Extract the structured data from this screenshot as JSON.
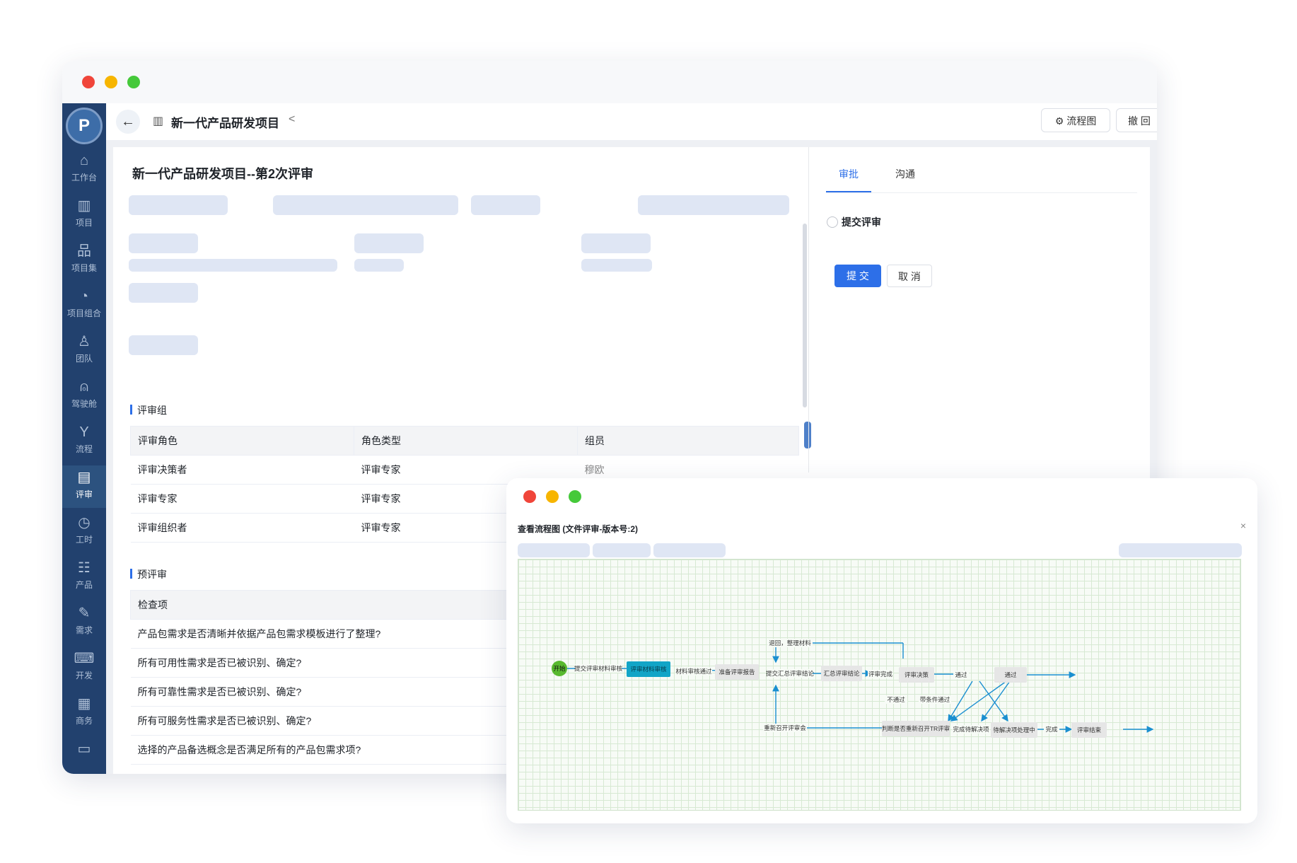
{
  "window": {
    "project_title": "新一代产品研发项目",
    "btn_flowchart": "流程图",
    "btn_withdraw": "撤 回",
    "btn_more": "···",
    "back_icon": "arrow-left-icon",
    "share_icon": "share-icon"
  },
  "sidebar": {
    "logo": "P",
    "items": [
      {
        "label": "工作台",
        "icon": "home-icon"
      },
      {
        "label": "项目",
        "icon": "board-icon"
      },
      {
        "label": "项目集",
        "icon": "hierarchy-icon"
      },
      {
        "label": "项目组合",
        "icon": "gauge-icon"
      },
      {
        "label": "团队",
        "icon": "team-icon"
      },
      {
        "label": "驾驶舱",
        "icon": "alarm-icon"
      },
      {
        "label": "流程",
        "icon": "branch-icon"
      },
      {
        "label": "评审",
        "icon": "review-icon"
      },
      {
        "label": "工时",
        "icon": "clock-icon"
      },
      {
        "label": "产品",
        "icon": "grid-list-icon"
      },
      {
        "label": "需求",
        "icon": "edit-icon"
      },
      {
        "label": "开发",
        "icon": "terminal-icon"
      },
      {
        "label": "商务",
        "icon": "business-icon"
      },
      {
        "label": "",
        "icon": "book-icon"
      }
    ],
    "icons_glyph": [
      "⌂",
      "▥",
      "品",
      "◔",
      "♙",
      "⍝",
      "Y",
      "▤",
      "◷",
      "☷",
      "✎",
      "⌨",
      "▦",
      "▭"
    ]
  },
  "doc": {
    "title": "新一代产品研发项目--第2次评审",
    "review_group_heading": "评审组",
    "review_group": {
      "headers": [
        "评审角色",
        "角色类型",
        "组员"
      ],
      "rows": [
        [
          "评审决策者",
          "评审专家",
          "穆欧"
        ],
        [
          "评审专家",
          "评审专家",
          ""
        ],
        [
          "评审组织者",
          "评审专家",
          ""
        ]
      ]
    },
    "prereview_heading": "预评审",
    "prereview": {
      "header": "检查项",
      "rows": [
        "产品包需求是否清晰并依据产品包需求模板进行了整理?",
        "所有可用性需求是否已被识别、确定?",
        "所有可靠性需求是否已被识别、确定?",
        "所有可服务性需求是否已被识别、确定?",
        "选择的产品备选概念是否满足所有的产品包需求项?"
      ]
    }
  },
  "right_panel": {
    "tabs": [
      "审批",
      "沟通"
    ],
    "active_tab": "审批",
    "option": "提交评审",
    "submit": "提 交",
    "cancel": "取 消"
  },
  "popup": {
    "title": "查看流程图 (文件评审-版本号:2)",
    "close": "×",
    "flow": {
      "nodes": {
        "start": "开始",
        "n1": "评审材料审核",
        "n2": "准备评审报告",
        "n3": "汇总评审结论",
        "n4": "评审决策",
        "n5": "通过",
        "n6": "判断是否重新召开TR评审",
        "n7": "待解决项处理中",
        "n8": "评审结束"
      },
      "edges": {
        "e1": "提交评审材料审核",
        "e2": "材料审核通过",
        "e3": "提交汇总评审结论",
        "e4": "评审完成",
        "e5": "通过",
        "e_back": "退回，整理材料",
        "e_fail": "不通过",
        "e_cond": "带条件通过",
        "e_reopen": "重新召开评审会",
        "e_finish_items": "完成待解决项",
        "e_done": "完成"
      }
    }
  },
  "colors": {
    "sidebar": "#22416e",
    "accent": "#2d6fe8",
    "start_node": "#58b92f",
    "active_node": "#12a5c7",
    "node": "#e6e6e6"
  }
}
